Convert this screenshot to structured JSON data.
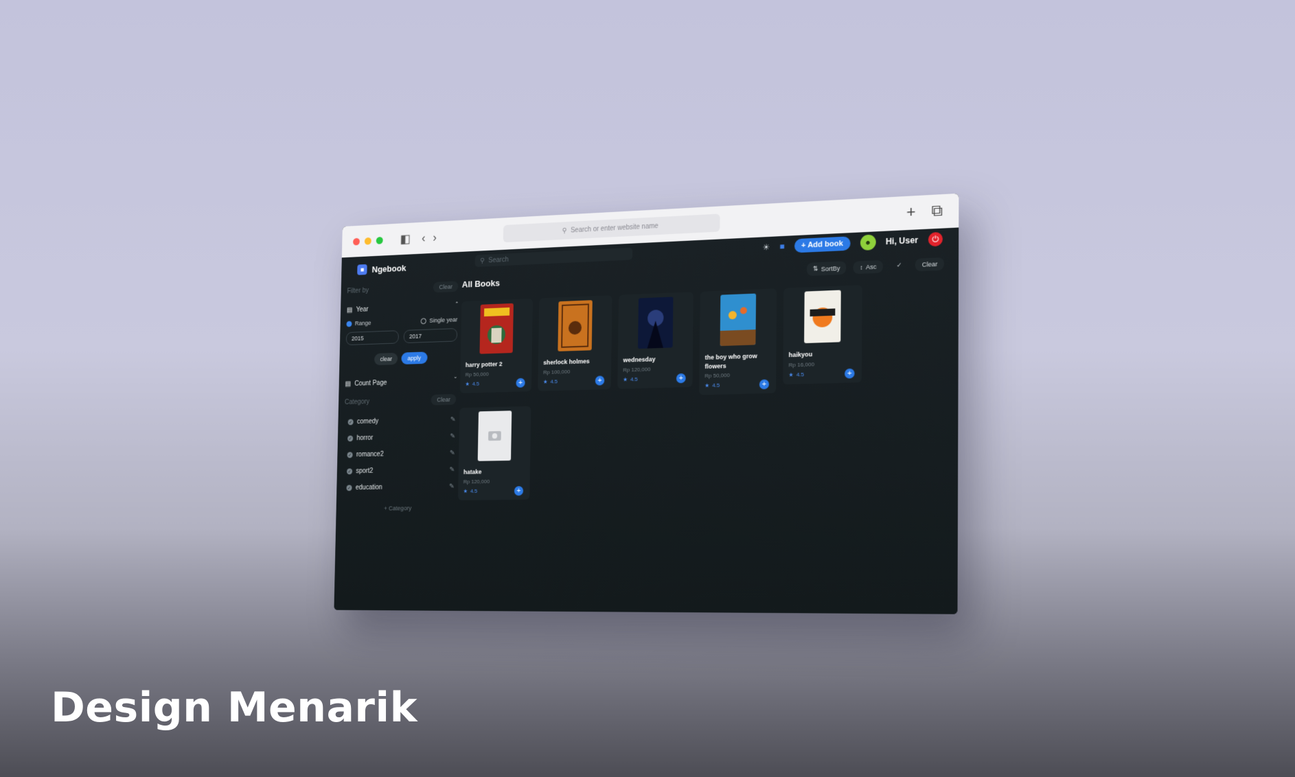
{
  "headline": "Design Menarik",
  "browser": {
    "url_placeholder": "Search or enter website name",
    "colors": {
      "close": "#ff5f57",
      "minimize": "#febc2e",
      "maximize": "#28c840"
    }
  },
  "app": {
    "brand": "Ngebook",
    "search_placeholder": "Search",
    "add_book_label": "Add book",
    "greeting": "Hi, User",
    "accent": "#2c7ae6",
    "logout_color": "#e2232c"
  },
  "sidebar": {
    "filter_label": "Filter by",
    "clear_label": "Clear",
    "year": {
      "label": "Year",
      "range_label": "Range",
      "single_label": "Single year",
      "selected_mode": "Range",
      "from": "2015",
      "to": "2017",
      "clear_btn": "clear",
      "apply_btn": "apply"
    },
    "count_page_label": "Count Page",
    "category_label": "Category",
    "category_clear": "Clear",
    "categories": [
      "comedy",
      "horror",
      "romance2",
      "sport2",
      "education"
    ],
    "add_category": "Category"
  },
  "main": {
    "title": "All Books",
    "sort_label": "SortBy",
    "order_label": "Asc",
    "clear_label": "Clear",
    "books": [
      {
        "title": "harry potter 2",
        "price": "Rp 50,000",
        "rating": "4.5"
      },
      {
        "title": "sherlock holmes",
        "price": "Rp 100,000",
        "rating": "4.5"
      },
      {
        "title": "wednesday",
        "price": "Rp 120,000",
        "rating": "4.5"
      },
      {
        "title": "the boy who grow flowers",
        "price": "Rp 50,000",
        "rating": "4.5"
      },
      {
        "title": "haikyou",
        "price": "Rp 16,000",
        "rating": "4.5"
      },
      {
        "title": "hatake",
        "price": "Rp 120,000",
        "rating": "4.5"
      }
    ]
  }
}
